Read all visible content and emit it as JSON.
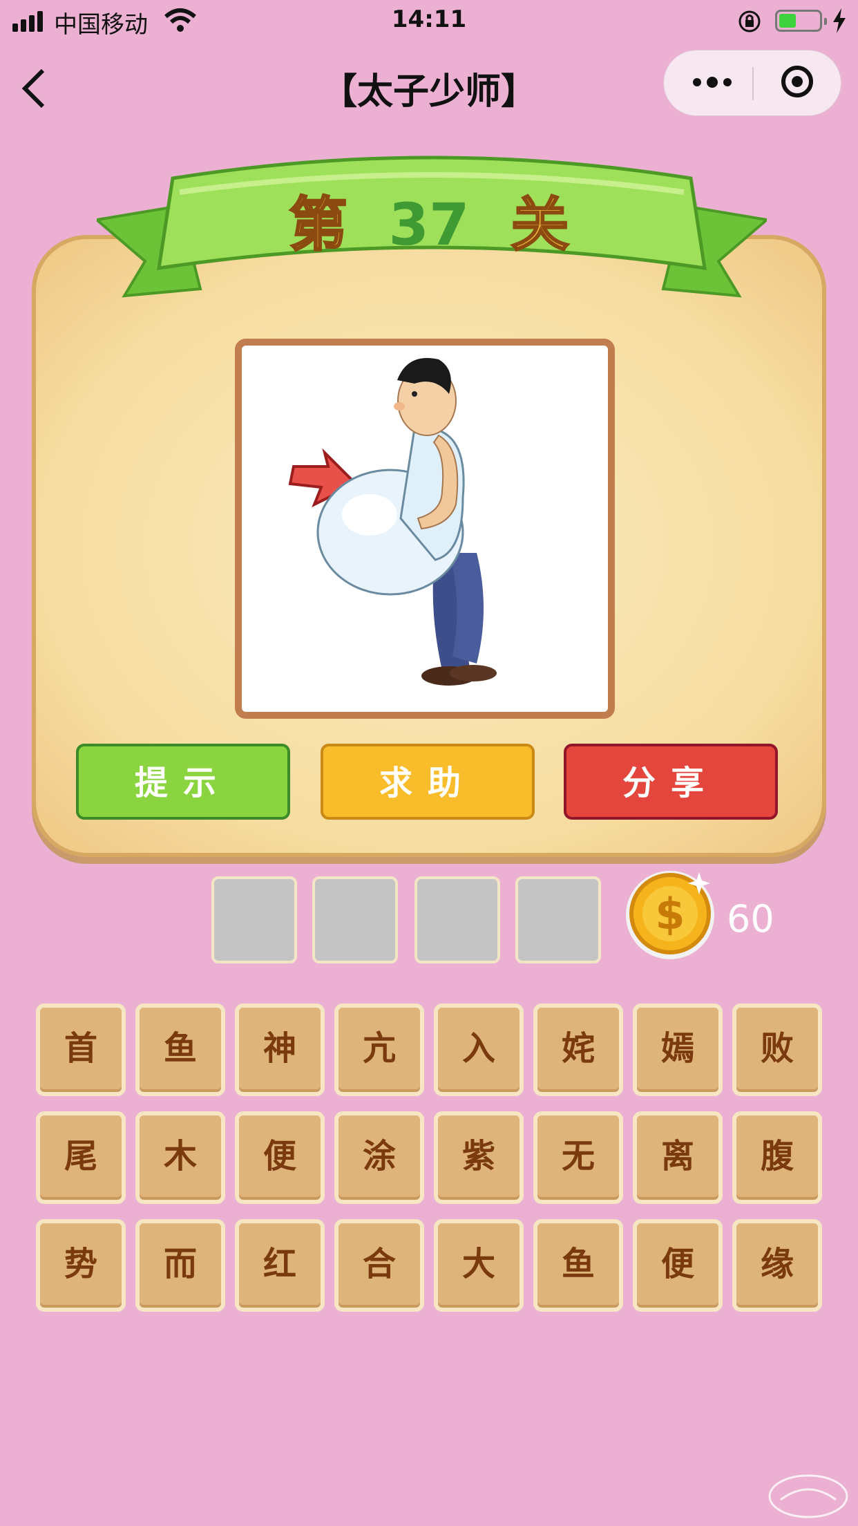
{
  "status_bar": {
    "carrier": "中国移动",
    "time": "14:11"
  },
  "nav": {
    "back_icon": "chevron-left-icon",
    "title": "【太子少师】",
    "more_icon": "more-dots-icon",
    "close_icon": "target-circle-icon"
  },
  "level": {
    "prefix": "第",
    "number": "37",
    "suffix": "关"
  },
  "puzzle": {
    "image": "fat-man-belly-with-red-arrow"
  },
  "buttons": {
    "hint": "提示",
    "help": "求助",
    "share": "分享"
  },
  "answer": {
    "slots": [
      "",
      "",
      "",
      ""
    ]
  },
  "coins": "60",
  "letters": [
    [
      "首",
      "鱼",
      "神",
      "亢",
      "入",
      "姹",
      "嫣",
      "败"
    ],
    [
      "尾",
      "木",
      "便",
      "涂",
      "紫",
      "无",
      "离",
      "腹"
    ],
    [
      "势",
      "而",
      "红",
      "合",
      "大",
      "鱼",
      "便",
      "缘"
    ]
  ],
  "colors": {
    "background": "#ebb0d2",
    "hint": "#8ad43f",
    "help": "#f9bd2c",
    "share": "#e4463d",
    "tile": "#dfb47a"
  }
}
